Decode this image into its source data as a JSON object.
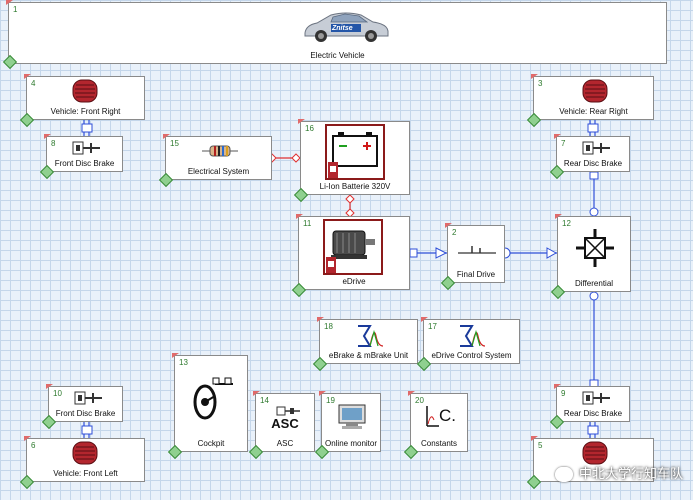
{
  "blocks": {
    "vehicle": {
      "num": "1",
      "label": "Electric Vehicle"
    },
    "front_right": {
      "num": "4",
      "label": "Vehicle: Front Right"
    },
    "front_disc_brake_r": {
      "num": "8",
      "label": "Front Disc Brake"
    },
    "electrical_system": {
      "num": "15",
      "label": "Electrical System"
    },
    "battery": {
      "num": "16",
      "label": "Li-Ion Batterie 320V"
    },
    "rear_right": {
      "num": "3",
      "label": "Vehicle: Rear Right"
    },
    "rear_disc_brake_r": {
      "num": "7",
      "label": "Rear Disc Brake"
    },
    "edrive": {
      "num": "11",
      "label": "eDrive"
    },
    "final_drive": {
      "num": "2",
      "label": "Final Drive"
    },
    "differential": {
      "num": "12",
      "label": "Differential"
    },
    "ebrake": {
      "num": "18",
      "label": "eBrake & mBrake Unit"
    },
    "edrive_control": {
      "num": "17",
      "label": "eDrive Control System"
    },
    "cockpit": {
      "num": "13",
      "label": "Cockpit"
    },
    "asc": {
      "num": "14",
      "label": "ASC",
      "icon_text": "ASC"
    },
    "online_monitor": {
      "num": "19",
      "label": "Online monitor"
    },
    "constants": {
      "num": "20",
      "label": "Constants",
      "icon_text": "C."
    },
    "front_disc_brake_l": {
      "num": "10",
      "label": "Front Disc Brake"
    },
    "front_left": {
      "num": "6",
      "label": "Vehicle: Front Left"
    },
    "rear_disc_brake_l": {
      "num": "9",
      "label": "Rear Disc Brake"
    },
    "rear_left": {
      "num": "5",
      "label": ""
    }
  },
  "car_logo_text": "Znitse",
  "watermark": "中北大学行知车队",
  "colors": {
    "wire_blue": "#2f4fd8",
    "wire_red": "#e03030",
    "flag": "#e06a6a",
    "diamond": "#8fd08f",
    "background": "#e9f1fa"
  }
}
